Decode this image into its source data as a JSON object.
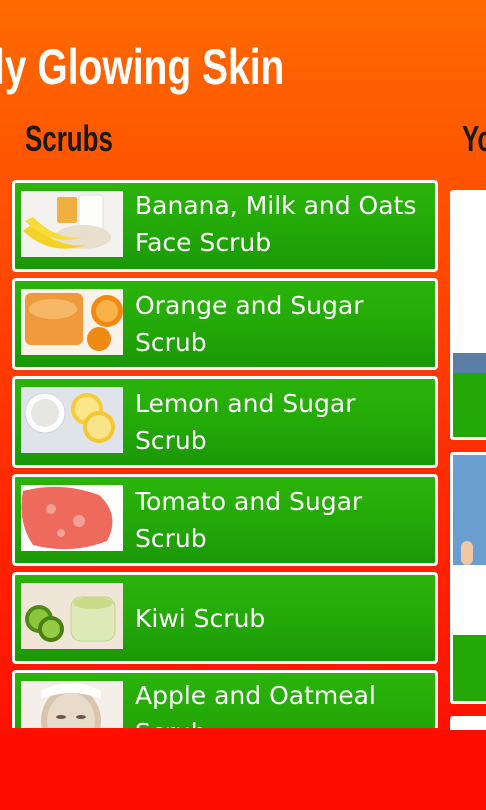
{
  "header": {
    "title": "ly Glowing Skin"
  },
  "sections": {
    "scrubs": "Scrubs",
    "next": "Yo"
  },
  "scrubs": [
    {
      "label": "Banana, Milk and Oats Face Scrub",
      "thumb": "banana-milk-oats-image"
    },
    {
      "label": "Orange and Sugar Scrub",
      "thumb": "orange-sugar-image"
    },
    {
      "label": "Lemon and Sugar Scrub",
      "thumb": "lemon-sugar-image"
    },
    {
      "label": "Tomato and Sugar Scrub",
      "thumb": "tomato-sugar-image"
    },
    {
      "label": "Kiwi Scrub",
      "thumb": "kiwi-image"
    },
    {
      "label": "Apple and Oatmeal Scrub",
      "thumb": "apple-oatmeal-image"
    }
  ],
  "colors": {
    "tile_green": "#23a808",
    "background_top": "#ff6a00",
    "background_bottom": "#ff0a00"
  }
}
